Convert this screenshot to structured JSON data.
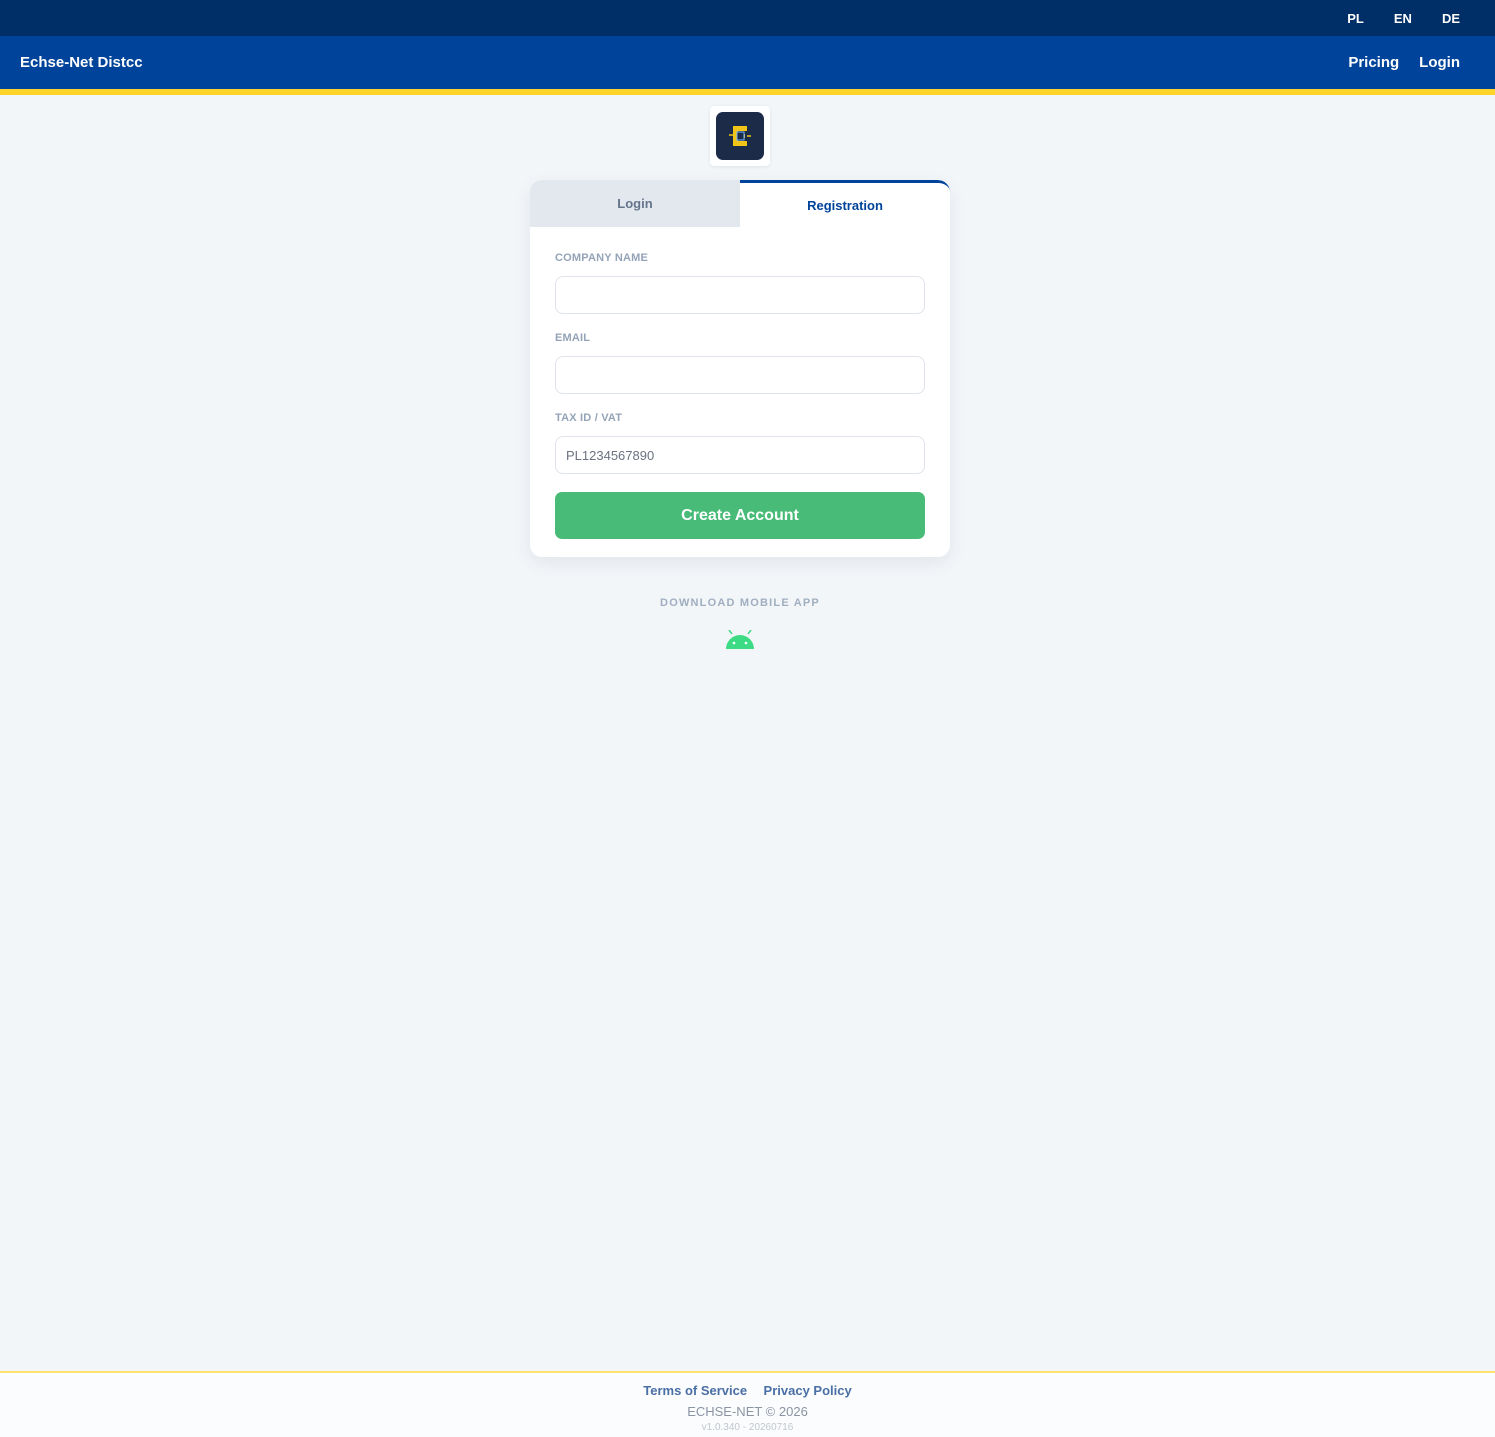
{
  "topbar": {
    "languages": [
      "PL",
      "EN",
      "DE"
    ]
  },
  "navbar": {
    "brand": "Echse-Net Distcc",
    "links": [
      "Pricing",
      "Login"
    ]
  },
  "tabs": {
    "login": "Login",
    "registration": "Registration",
    "active": "registration"
  },
  "form": {
    "company_name_label": "COMPANY NAME",
    "company_name_value": "",
    "email_label": "EMAIL",
    "email_value": "",
    "tax_label": "TAX ID / VAT",
    "tax_placeholder": "PL1234567890",
    "submit_label": "Create Account"
  },
  "download": {
    "label": "DOWNLOAD MOBILE APP",
    "icon": "android-icon"
  },
  "footer": {
    "terms": "Terms of Service",
    "privacy": "Privacy Policy",
    "copyright": "ECHSE-NET © 2026",
    "version": "v1.0.340 - 20260716"
  },
  "colors": {
    "topbar": "#002e66",
    "navbar": "#00439a",
    "accent_yellow": "#ffd42a",
    "button_green": "#48bb78"
  }
}
